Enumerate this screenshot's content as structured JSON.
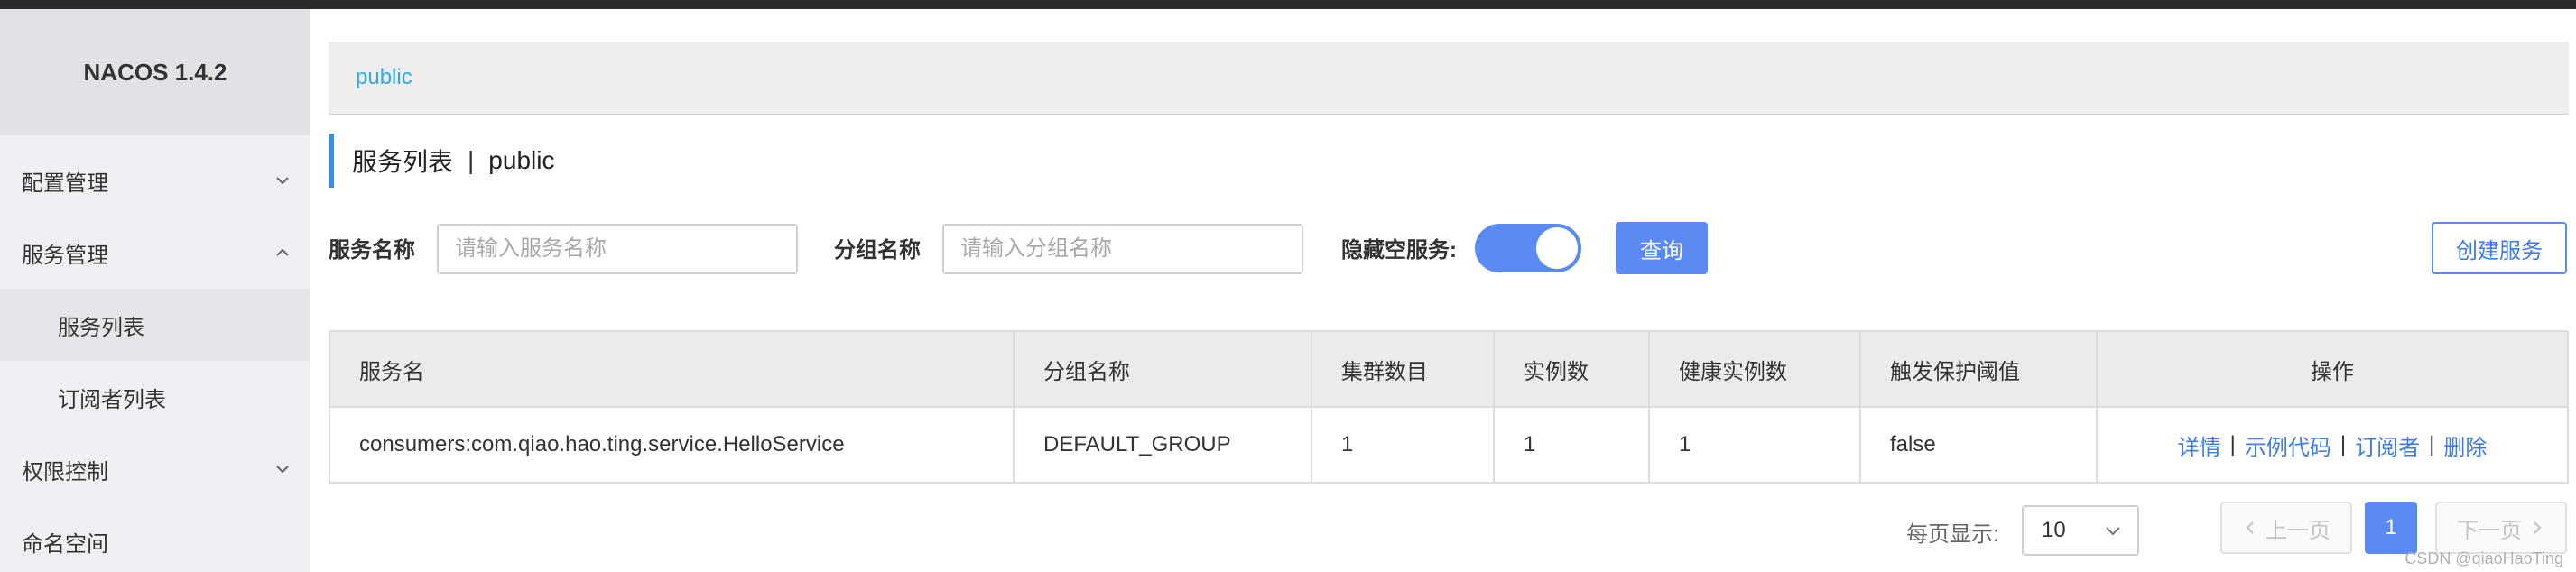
{
  "sidebar": {
    "brand": "NACOS 1.4.2",
    "items": [
      {
        "label": "配置管理"
      },
      {
        "label": "服务管理"
      },
      {
        "label": "服务列表"
      },
      {
        "label": "订阅者列表"
      },
      {
        "label": "权限控制"
      },
      {
        "label": "命名空间"
      }
    ]
  },
  "namespace_bar": {
    "label": "public"
  },
  "page_title": {
    "main": "服务列表",
    "separator": "|",
    "namespace": "public"
  },
  "filters": {
    "service_name_label": "服务名称",
    "service_name_placeholder": "请输入服务名称",
    "group_name_label": "分组名称",
    "group_name_placeholder": "请输入分组名称",
    "hide_empty_label": "隐藏空服务:",
    "hide_empty_on": true,
    "query_label": "查询",
    "create_label": "创建服务"
  },
  "table": {
    "headers": [
      "服务名",
      "分组名称",
      "集群数目",
      "实例数",
      "健康实例数",
      "触发保护阈值",
      "操作"
    ],
    "rows": [
      {
        "service": "consumers:com.qiao.hao.ting.service.HelloService",
        "group": "DEFAULT_GROUP",
        "clusters": "1",
        "instances": "1",
        "healthy": "1",
        "threshold": "false",
        "actions": [
          "详情",
          "示例代码",
          "订阅者",
          "删除"
        ]
      }
    ]
  },
  "pagination": {
    "per_page_label": "每页显示:",
    "per_page_value": "10",
    "prev_label": "上一页",
    "next_label": "下一页",
    "current_page": "1"
  },
  "watermark": "CSDN @qiaoHaoTing",
  "colors": {
    "accent": "#5b8bf2",
    "link": "#3c7be8",
    "namespace": "#33a9e0"
  }
}
